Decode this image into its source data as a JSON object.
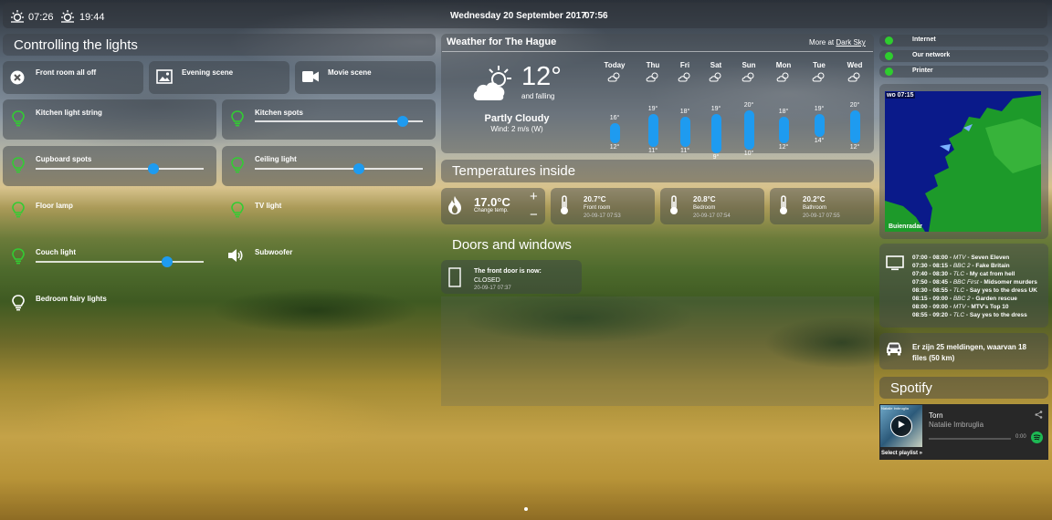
{
  "top": {
    "sunrise": "07:26",
    "sunset": "19:44",
    "date": "Wednesday 20 September 2017",
    "time": "07:56"
  },
  "lights": {
    "title": "Controlling the lights",
    "scenes": [
      "Front room all off",
      "Evening scene",
      "Movie scene"
    ],
    "items": [
      {
        "label": "Kitchen light string",
        "level": null
      },
      {
        "label": "Kitchen spots",
        "level": 0.88
      },
      {
        "label": "Cupboard spots",
        "level": 0.7
      },
      {
        "label": "Ceiling light",
        "level": 0.62
      },
      {
        "label": "Floor lamp",
        "level": null
      },
      {
        "label": "TV light",
        "level": null
      },
      {
        "label": "Couch light",
        "level": 0.78
      },
      {
        "label": "Subwoofer",
        "level": null
      },
      {
        "label": "Bedroom fairy lights",
        "level": null
      }
    ]
  },
  "weather": {
    "title": "Weather for The Hague",
    "more_prefix": "More at",
    "more_link": "Dark Sky",
    "temp": "12°",
    "trend": "and falling",
    "summary": "Partly Cloudy",
    "wind": "Wind: 2 m/s (W)",
    "days": [
      {
        "day": "Today",
        "high": "16°",
        "low": "12°"
      },
      {
        "day": "Thu",
        "high": "19°",
        "low": "11°"
      },
      {
        "day": "Fri",
        "high": "18°",
        "low": "11°"
      },
      {
        "day": "Sat",
        "high": "19°",
        "low": "9°"
      },
      {
        "day": "Sun",
        "high": "20°",
        "low": "10°"
      },
      {
        "day": "Mon",
        "high": "18°",
        "low": "12°"
      },
      {
        "day": "Tue",
        "high": "19°",
        "low": "14°"
      },
      {
        "day": "Wed",
        "high": "20°",
        "low": "12°"
      }
    ]
  },
  "temps_inside": {
    "title": "Temperatures inside",
    "thermostat_value": "17.0°C",
    "thermostat_label": "Change temp.",
    "plus": "+",
    "minus": "−",
    "sensors": [
      {
        "value": "20.7°C",
        "name": "Front room",
        "time": "20-09-17 07:53"
      },
      {
        "value": "20.8°C",
        "name": "Bedroom",
        "time": "20-09-17 07:54"
      },
      {
        "value": "20.2°C",
        "name": "Bathroom",
        "time": "20-09-17 07:55"
      }
    ]
  },
  "doors": {
    "title": "Doors and windows",
    "label": "The front door is now:",
    "state": "CLOSED",
    "time": "20-09-17 07:37"
  },
  "status": [
    "Internet",
    "Our network",
    "Printer"
  ],
  "radar": {
    "time": "wo 07:15",
    "brand": "Buienradar"
  },
  "tv": [
    {
      "time": "07:00 - 08:00",
      "ch": "MTV",
      "show": "Seven Eleven"
    },
    {
      "time": "07:30 - 08:15",
      "ch": "BBC 2",
      "show": "Fake Britain"
    },
    {
      "time": "07:40 - 08:30",
      "ch": "TLC",
      "show": "My cat from hell"
    },
    {
      "time": "07:50 - 08:45",
      "ch": "BBC First",
      "show": "Midsomer murders"
    },
    {
      "time": "08:30 - 08:55",
      "ch": "TLC",
      "show": "Say yes to the dress UK"
    },
    {
      "time": "08:15 - 09:00",
      "ch": "BBC 2",
      "show": "Garden rescue"
    },
    {
      "time": "08:00 - 09:00",
      "ch": "MTV",
      "show": "MTV's Top 10"
    },
    {
      "time": "08:55 - 09:20",
      "ch": "TLC",
      "show": "Say yes to the dress"
    }
  ],
  "traffic": "Er zijn 25 meldingen, waarvan 18 files (50 km)",
  "spotify": {
    "title": "Spotify",
    "track": "Torn",
    "artist": "Natalie Imbruglia",
    "position": "0:00",
    "select": "Select playlist »",
    "album_caption": "Natalie Imbruglia"
  },
  "colors": {
    "accent": "#1e9bf0",
    "bulb_on": "#33cc33",
    "status_ok": "#2ecc2e",
    "spotify": "#1db954"
  }
}
